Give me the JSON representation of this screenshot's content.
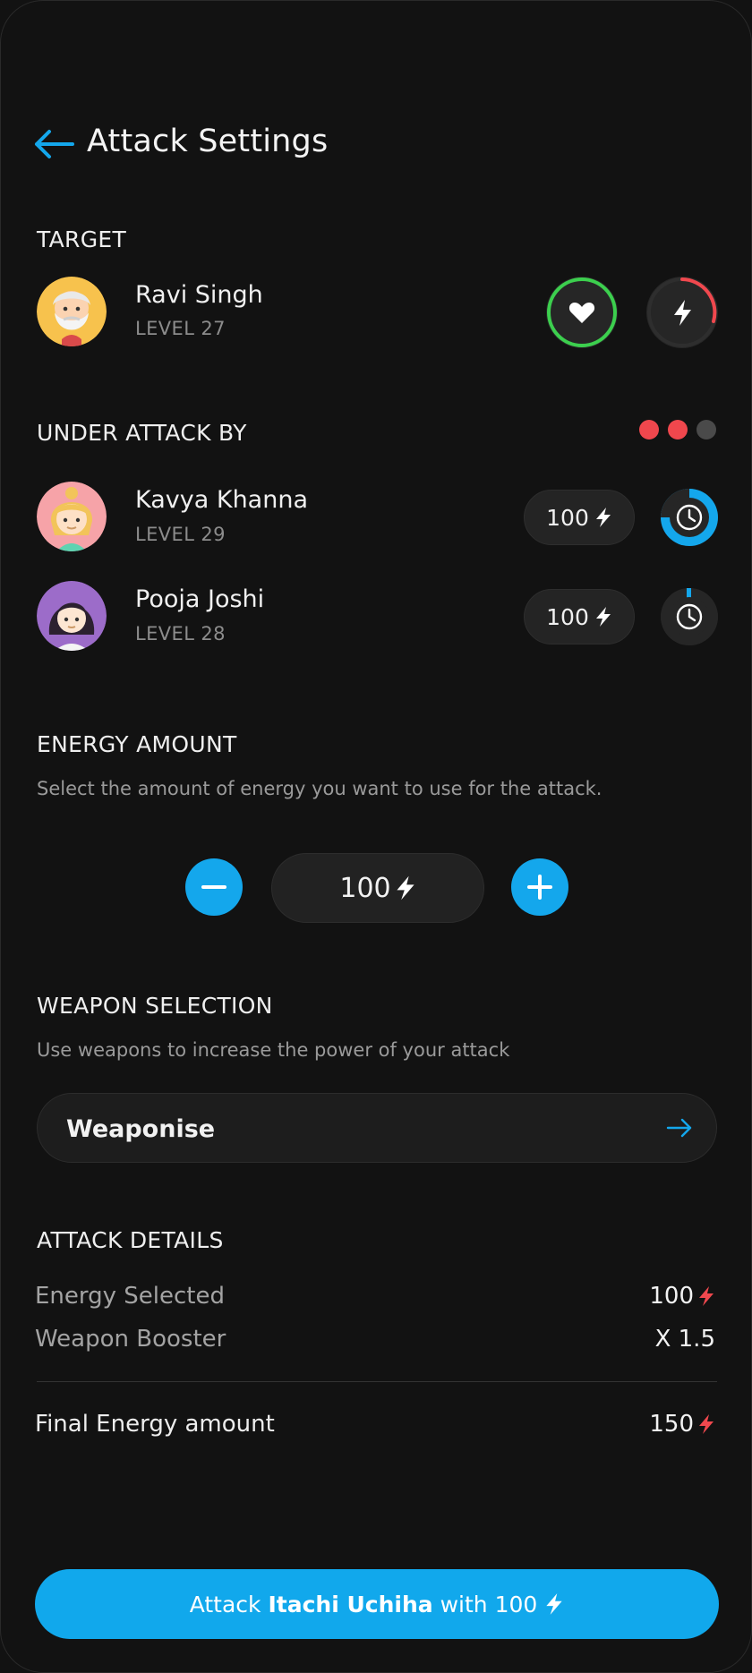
{
  "header": {
    "title": "Attack Settings"
  },
  "target": {
    "section_label": "TARGET",
    "name": "Ravi Singh",
    "level": "LEVEL 27",
    "health_ring_color": "#3ccf4e",
    "energy_ring_color": "#f0484e"
  },
  "under_attack": {
    "section_label": "UNDER ATTACK BY",
    "indicator_colors": [
      "#f0474d",
      "#f0474d",
      "#4a4a4a"
    ],
    "attackers": [
      {
        "name": "Kavya Khanna",
        "level": "LEVEL 29",
        "energy": "100",
        "timer_color": "#14a7ec"
      },
      {
        "name": "Pooja Joshi",
        "level": "LEVEL 28",
        "energy": "100",
        "timer_color": "#14a7ec"
      }
    ]
  },
  "energy_amount": {
    "section_label": "ENERGY AMOUNT",
    "hint": "Select the amount of energy you want to use for the attack.",
    "value": "100",
    "decrease_icon": "minus-icon",
    "increase_icon": "plus-icon"
  },
  "weapon_selection": {
    "section_label": "WEAPON SELECTION",
    "hint": "Use weapons to increase the power of your attack",
    "field_label": "Weaponise",
    "arrow_icon": "arrow-right-icon"
  },
  "attack_details": {
    "section_label": "ATTACK DETAILS",
    "rows": [
      {
        "label": "Energy Selected",
        "value": "100"
      },
      {
        "label": "Weapon Booster",
        "value": "X 1.5"
      }
    ],
    "final_label": "Final Energy amount",
    "final_value": "150"
  },
  "attack_button": {
    "prefix": "Attack ",
    "target_name": "Itachi Uchiha",
    "suffix": " with 100"
  },
  "colors": {
    "accent": "#14a7ec",
    "background": "#121212",
    "bolt_red": "#f0484e"
  }
}
